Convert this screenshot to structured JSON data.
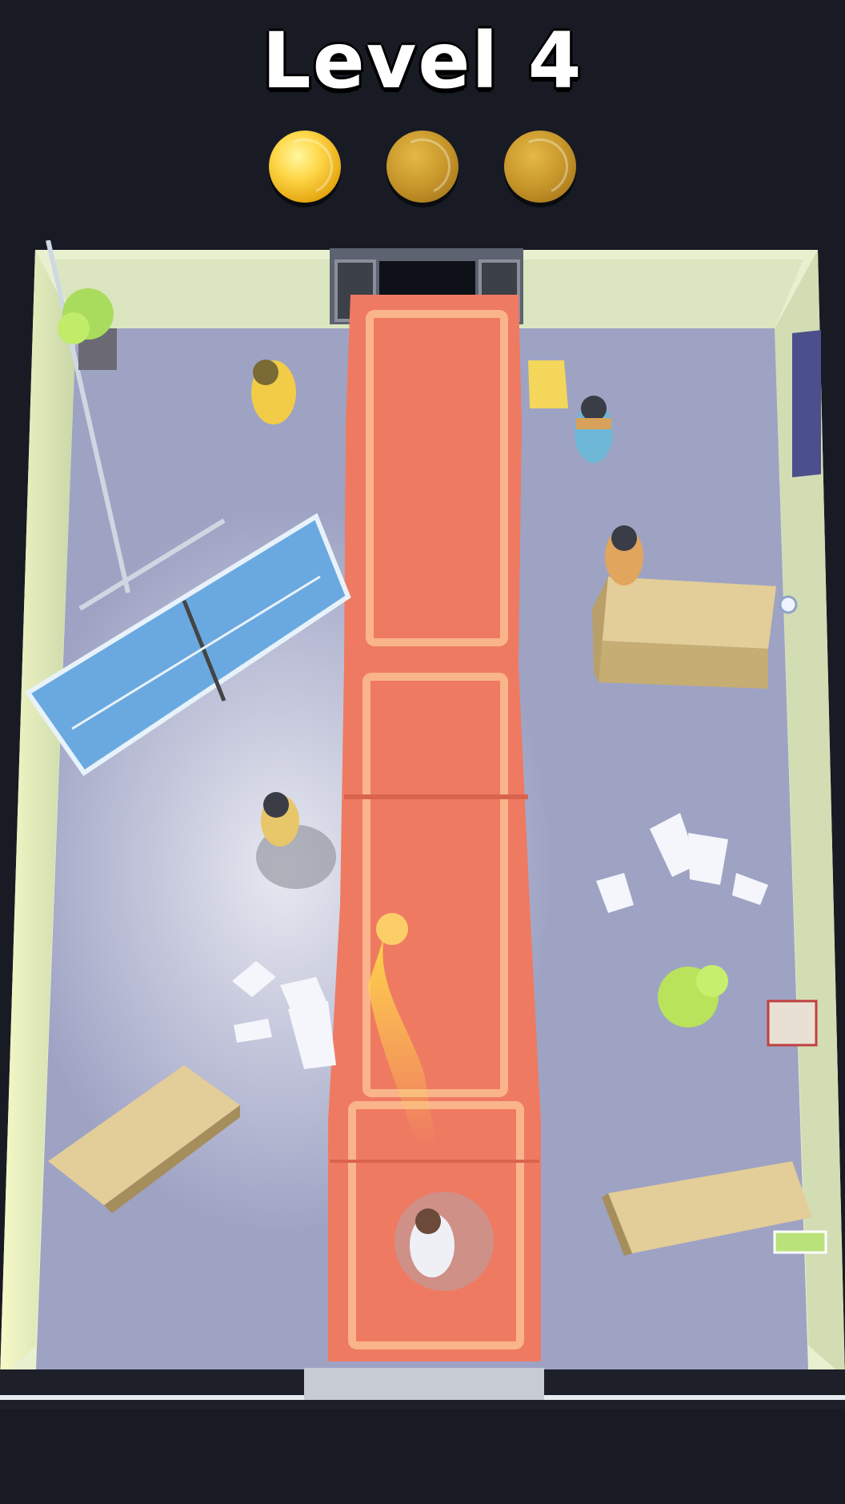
{
  "hud": {
    "level_label": "Level 4",
    "stars_earned": 1,
    "stars_total": 3
  },
  "colors": {
    "background": "#181b24",
    "floor": "#9ea3c4",
    "carpet": "#ef7a62",
    "wall": "#dfe8c6",
    "ping_pong_table": "#6aa9e0",
    "coin_gold": "#f2c321"
  },
  "scene": {
    "player": "player-character",
    "enemies": [
      "enemy-yellow-hazmat",
      "enemy-guard-blue",
      "enemy-guard-orange",
      "enemy-guard-left"
    ],
    "props": [
      "ping-pong-table",
      "wet-floor-sign",
      "potted-plant",
      "wooden-crates",
      "scattered-papers",
      "wall-poster",
      "book-stack",
      "cash-bundle"
    ]
  }
}
